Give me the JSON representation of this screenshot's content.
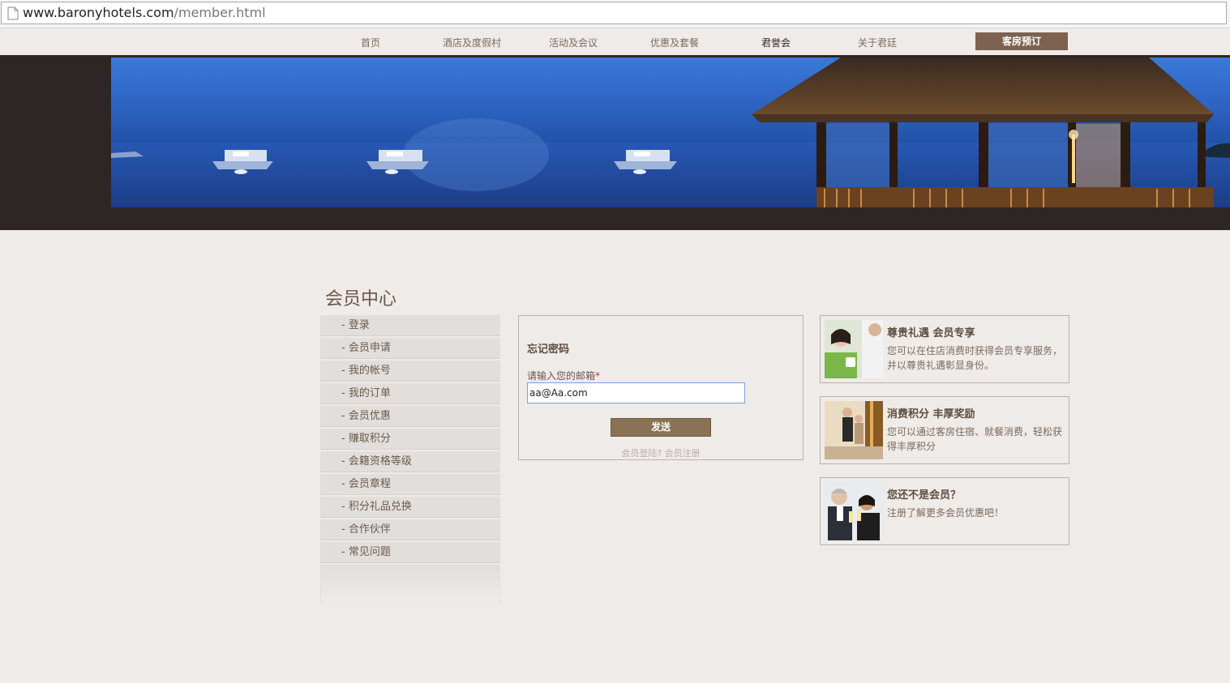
{
  "browser": {
    "url_host": "www.baronyhotels.com",
    "url_path": "/member.html"
  },
  "nav": {
    "items": [
      "首页",
      "酒店及度假村",
      "活动及会议",
      "优惠及套餐",
      "君誉会",
      "关于君廷"
    ],
    "book_label": "客房预订"
  },
  "page": {
    "title": "会员中心"
  },
  "sidebar": {
    "items": [
      "- 登录",
      "- 会员申请",
      "- 我的帐号",
      "- 我的订单",
      "- 会员优惠",
      "- 赚取积分",
      "- 会籍资格等级",
      "- 会员章程",
      "- 积分礼品兑换",
      "- 合作伙伴",
      "- 常见问题"
    ]
  },
  "form": {
    "title": "忘记密码",
    "email_label": "请输入您的邮箱",
    "required_mark": "*",
    "email_value": "aa@Aa.com",
    "send_label": "发送",
    "login_link": "会员登陆?",
    "register_link": "会员注册"
  },
  "promos": [
    {
      "title": "尊贵礼遇 会员专享",
      "text": "您可以在住店消费时获得会员专享服务，并以尊贵礼遇彰显身份。"
    },
    {
      "title": "消费积分 丰厚奖励",
      "text": "您可以通过客房住宿、就餐消费，轻松获得丰厚积分"
    },
    {
      "title": "您还不是会员？",
      "text": "注册了解更多会员优惠吧！"
    }
  ],
  "colors": {
    "background": "#efebe8",
    "hero_band": "#2e2624",
    "book_button": "#7d6250",
    "send_button": "#8a7355"
  }
}
